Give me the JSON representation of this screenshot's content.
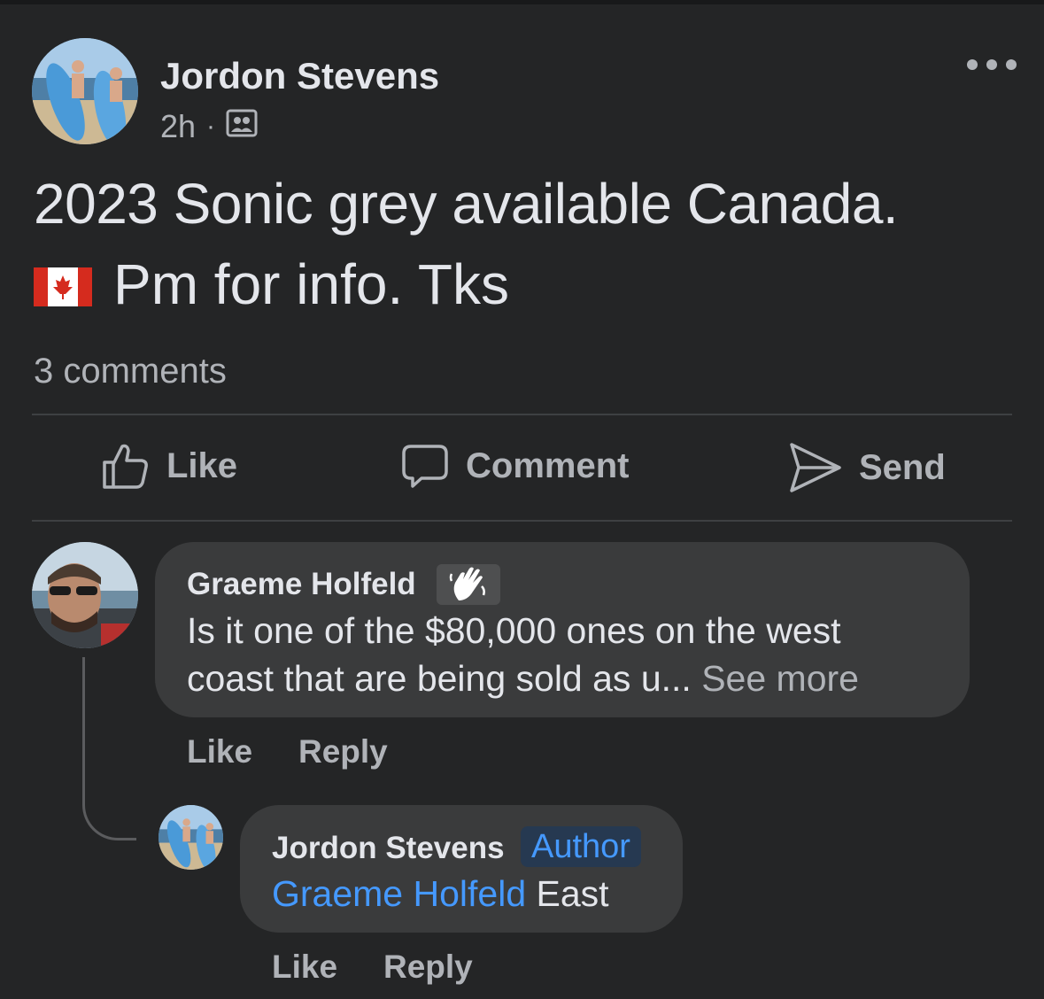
{
  "post": {
    "author": "Jordon Stevens",
    "time": "2h",
    "separator": "·",
    "audience_icon": "group-audience-icon",
    "text_line1": "2023 Sonic grey available Canada.",
    "text_line2": "Pm for info. Tks",
    "flag": "canada-flag-emoji",
    "comments_count": "3 comments"
  },
  "actions": {
    "like": "Like",
    "comment": "Comment",
    "send": "Send"
  },
  "comments": [
    {
      "author": "Graeme Holfeld",
      "badge_icon": "wave-hand-icon",
      "text_line1": "Is it one of the $80,000 ones on the west",
      "text_line2": "coast that are being sold as u...",
      "see_more": "See more",
      "like": "Like",
      "reply": "Reply"
    },
    {
      "author": "Jordon Stevens",
      "badge": "Author",
      "mention": "Graeme Holfeld",
      "text": "East",
      "like": "Like",
      "reply": "Reply"
    }
  ],
  "colors": {
    "background": "#242526",
    "bubble": "#3a3b3c",
    "text": "#e4e6eb",
    "secondary": "#b0b3b8",
    "link": "#4599ff"
  }
}
